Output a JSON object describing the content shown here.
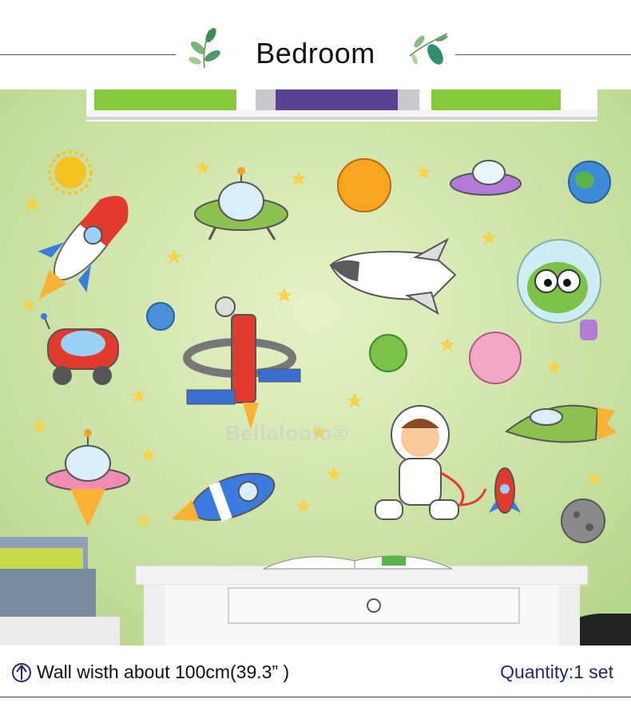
{
  "header": {
    "title": "Bedroom"
  },
  "watermark": "Bellaloolo®",
  "footer": {
    "width_text": "Wall wisth about  100cm(39.3” )",
    "quantity_text": "Quantity:1 set"
  },
  "colors": {
    "wall": "#cfe6a8",
    "shelf_basket_green": "#86c93a",
    "shelf_basket_purple": "#6a4bb0",
    "desk": "#f2f2f0",
    "footer_blue": "#1f2a6b"
  },
  "icons": [
    "leaf-icon",
    "ruler-icon"
  ]
}
